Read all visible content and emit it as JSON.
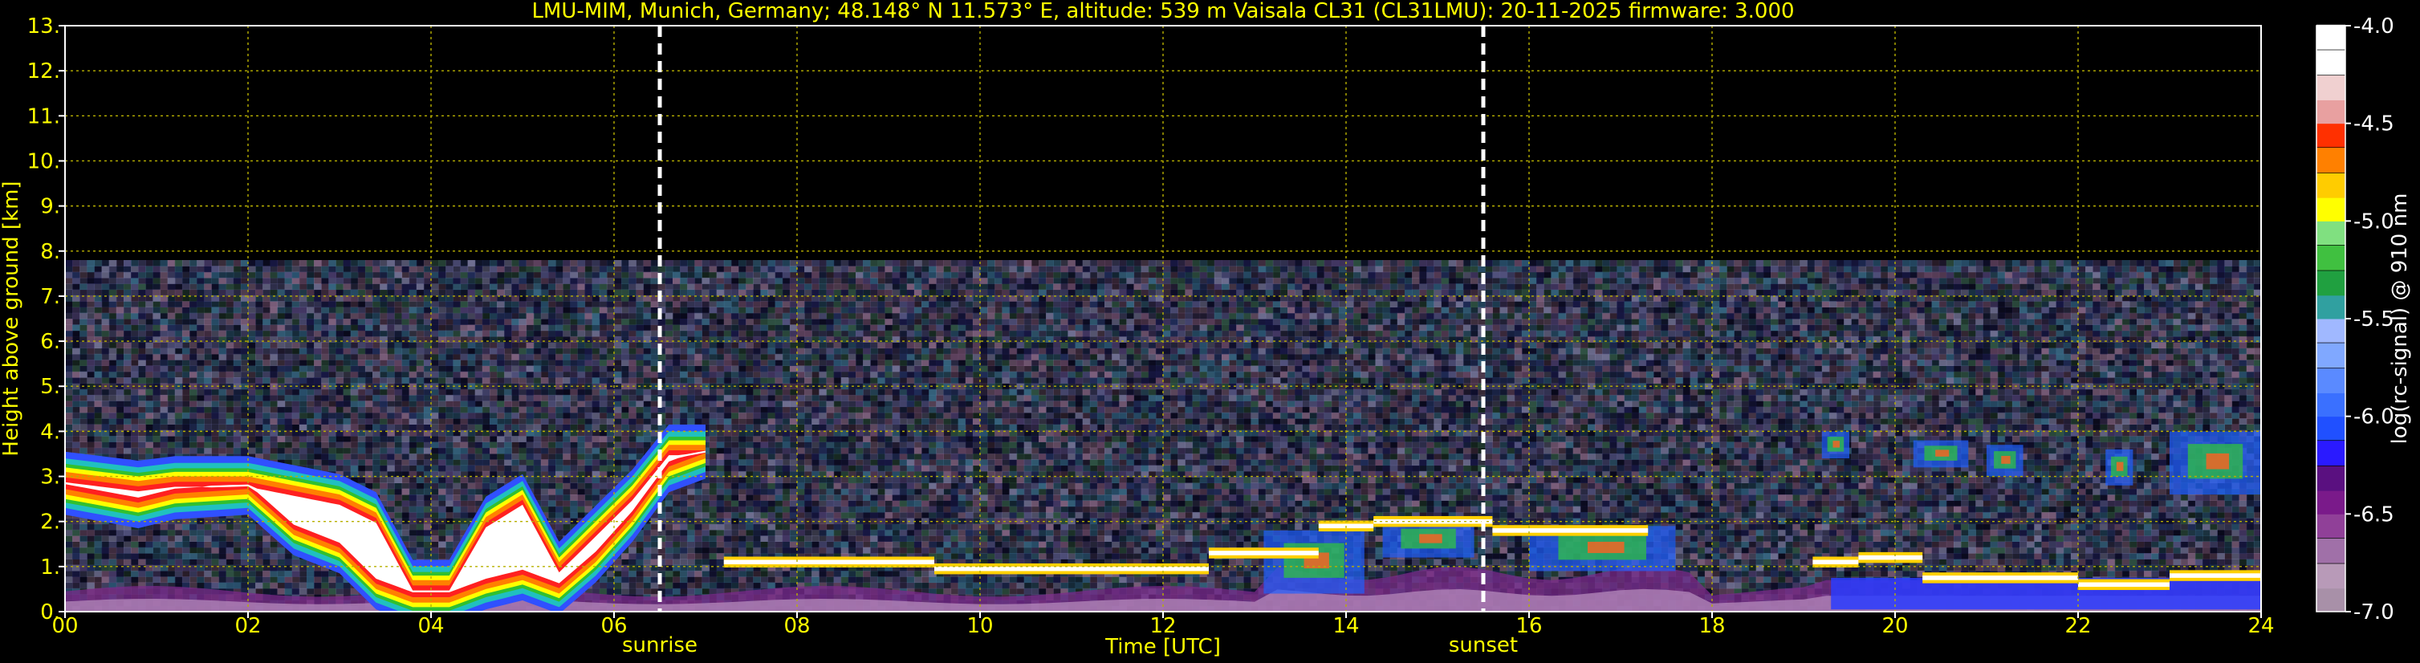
{
  "chart_data": {
    "type": "heatmap",
    "title": "LMU-MIM, Munich, Germany; 48.148° N 11.573° E, altitude: 539 m    Vaisala CL31 (CL31LMU): 20-11-2025    firmware: 3.000",
    "xlabel": "Time [UTC]",
    "ylabel": "Height above ground [km]",
    "xlim": [
      0,
      24
    ],
    "ylim": [
      0,
      13
    ],
    "x_ticks": [
      "00",
      "02",
      "04",
      "06",
      "08",
      "10",
      "12",
      "14",
      "16",
      "18",
      "20",
      "22",
      "24"
    ],
    "y_ticks": [
      "0.",
      "1.",
      "2.",
      "3.",
      "4.",
      "5.",
      "6.",
      "7.",
      "8.",
      "9.",
      "10.",
      "11.",
      "12.",
      "13."
    ],
    "grid": true,
    "colorbar": {
      "label": "log(rc-signal) @ 910 nm",
      "range": [
        -7.0,
        -4.0
      ],
      "ticks": [
        "-4.0",
        "-4.5",
        "-5.0",
        "-5.5",
        "-6.0",
        "-6.5",
        "-7.0"
      ]
    },
    "annotations": [
      {
        "text": "sunrise",
        "x": 6.5
      },
      {
        "text": "sunset",
        "x": 15.5
      }
    ],
    "signal_top_km": 7.7,
    "features": {
      "aerosol_layer": [
        {
          "x": 0.0,
          "top": 3.2,
          "bottom": 2.5
        },
        {
          "x": 0.8,
          "top": 3.0,
          "bottom": 2.2
        },
        {
          "x": 1.2,
          "top": 3.1,
          "bottom": 2.4
        },
        {
          "x": 2.0,
          "top": 3.1,
          "bottom": 2.5
        },
        {
          "x": 2.5,
          "top": 2.9,
          "bottom": 1.6
        },
        {
          "x": 3.0,
          "top": 2.7,
          "bottom": 1.2
        },
        {
          "x": 3.4,
          "top": 2.3,
          "bottom": 0.4
        },
        {
          "x": 3.8,
          "top": 0.8,
          "bottom": 0.1
        },
        {
          "x": 4.2,
          "top": 0.8,
          "bottom": 0.1
        },
        {
          "x": 4.6,
          "top": 2.2,
          "bottom": 0.4
        },
        {
          "x": 5.0,
          "top": 2.7,
          "bottom": 0.6
        },
        {
          "x": 5.4,
          "top": 1.2,
          "bottom": 0.3
        },
        {
          "x": 5.8,
          "top": 2.0,
          "bottom": 1.0
        },
        {
          "x": 6.2,
          "top": 2.8,
          "bottom": 1.9
        },
        {
          "x": 6.6,
          "top": 3.8,
          "bottom": 3.0
        },
        {
          "x": 7.0,
          "top": 3.8,
          "bottom": 3.3
        }
      ],
      "cloud_segments": [
        {
          "x0": 7.2,
          "x1": 9.5,
          "h": 1.1
        },
        {
          "x0": 9.5,
          "x1": 12.5,
          "h": 0.95
        },
        {
          "x0": 12.5,
          "x1": 13.7,
          "h": 1.3
        },
        {
          "x0": 13.7,
          "x1": 14.3,
          "h": 1.9
        },
        {
          "x0": 14.3,
          "x1": 15.6,
          "h": 2.0
        },
        {
          "x0": 15.6,
          "x1": 17.3,
          "h": 1.8
        },
        {
          "x0": 19.1,
          "x1": 19.6,
          "h": 1.1
        },
        {
          "x0": 19.6,
          "x1": 20.3,
          "h": 1.2
        },
        {
          "x0": 20.3,
          "x1": 22.0,
          "h": 0.75
        },
        {
          "x0": 22.0,
          "x1": 23.0,
          "h": 0.6
        },
        {
          "x0": 23.0,
          "x1": 24.0,
          "h": 0.8
        }
      ],
      "convective_patches": [
        {
          "x0": 13.1,
          "x1": 14.2,
          "y0": 0.4,
          "y1": 1.8
        },
        {
          "x0": 14.4,
          "x1": 15.4,
          "y0": 1.2,
          "y1": 2.0
        },
        {
          "x0": 16.0,
          "x1": 17.6,
          "y0": 0.9,
          "y1": 1.9
        },
        {
          "x0": 19.2,
          "x1": 19.5,
          "y0": 3.4,
          "y1": 4.0
        },
        {
          "x0": 20.2,
          "x1": 20.8,
          "y0": 3.2,
          "y1": 3.8
        },
        {
          "x0": 21.0,
          "x1": 21.4,
          "y0": 3.0,
          "y1": 3.7
        },
        {
          "x0": 22.3,
          "x1": 22.6,
          "y0": 2.8,
          "y1": 3.6
        },
        {
          "x0": 23.0,
          "x1": 24.0,
          "y0": 2.6,
          "y1": 4.0
        }
      ]
    }
  }
}
